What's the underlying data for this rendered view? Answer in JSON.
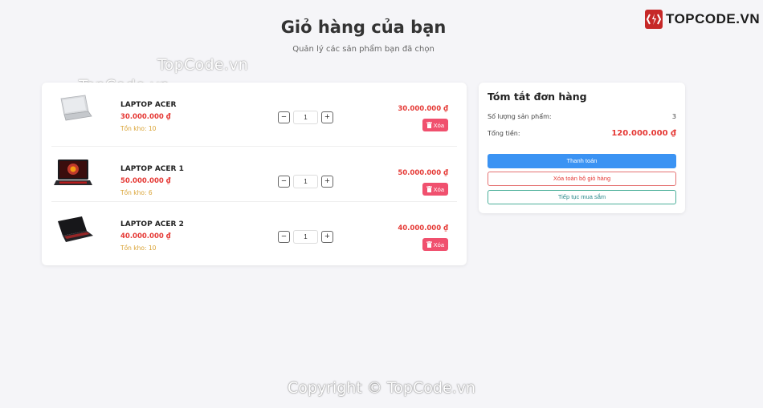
{
  "brand": {
    "logo_text": "TOPCODE.VN"
  },
  "watermarks": [
    "TopCode.vn",
    "TopCode.vn"
  ],
  "header": {
    "title": "Giỏ hàng của bạn",
    "subtitle": "Quản lý các sản phẩm bạn đã chọn"
  },
  "cart": {
    "items": [
      {
        "name": "LAPTOP ACER",
        "price": "30.000.000 ₫",
        "stock": "Tồn kho: 10",
        "quantity": "1",
        "line_total": "30.000.000 ₫",
        "delete_label": "Xóa",
        "minus": "−",
        "plus": "+",
        "image_icon": "laptop-silver"
      },
      {
        "name": "LAPTOP ACER 1",
        "price": "50.000.000 ₫",
        "stock": "Tồn kho: 6",
        "quantity": "1",
        "line_total": "50.000.000 ₫",
        "delete_label": "Xóa",
        "minus": "−",
        "plus": "+",
        "image_icon": "laptop-gaming-red"
      },
      {
        "name": "LAPTOP ACER 2",
        "price": "40.000.000 ₫",
        "stock": "Tồn kho: 10",
        "quantity": "1",
        "line_total": "40.000.000 ₫",
        "delete_label": "Xóa",
        "minus": "−",
        "plus": "+",
        "image_icon": "laptop-black"
      }
    ]
  },
  "summary": {
    "title": "Tóm tắt đơn hàng",
    "count_label": "Số lượng sản phẩm:",
    "count_value": "3",
    "total_label": "Tổng tiền:",
    "total_value": "120.000.000 ₫",
    "checkout_label": "Thanh toán",
    "clear_label": "Xóa toàn bộ giỏ hàng",
    "continue_label": "Tiếp tục mua sắm"
  },
  "footer": {
    "copyright": "Copyright © TopCode.vn"
  },
  "colors": {
    "accent_red": "#e53935",
    "primary_blue": "#3b93f3",
    "delete_pink": "#f0506e",
    "stock_amber": "#d9a233",
    "background": "#f5f5f8"
  }
}
